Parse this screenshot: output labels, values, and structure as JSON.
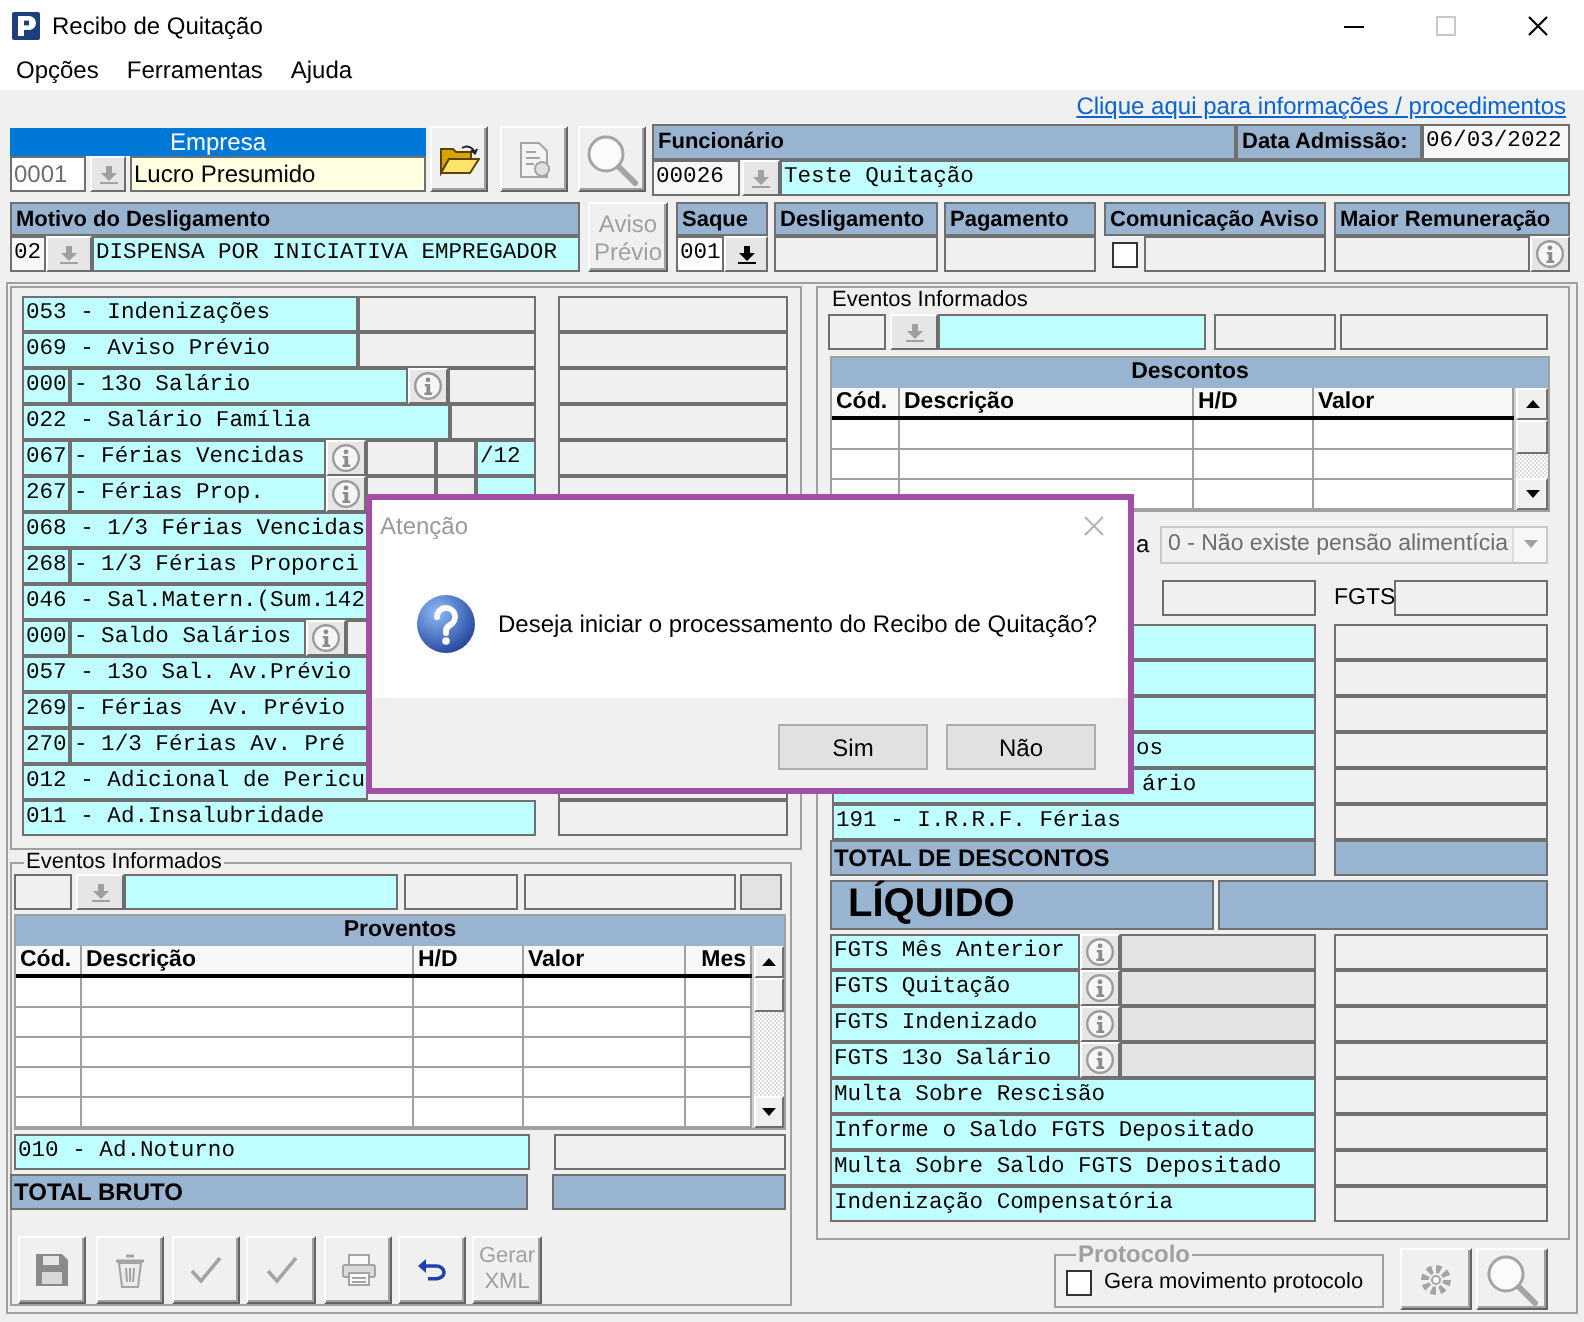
{
  "window": {
    "title": "Recibo de Quitação"
  },
  "menu": [
    "Opções",
    "Ferramentas",
    "Ajuda"
  ],
  "help_link": "Clique aqui para informações / procedimentos",
  "empresa": {
    "label": "Empresa",
    "code": "0001",
    "picker_disabled": true,
    "name": "Lucro Presumido"
  },
  "top_buttons": [
    {
      "kind": "open",
      "disabled": false
    },
    {
      "kind": "document",
      "disabled": true
    },
    {
      "kind": "search",
      "disabled": true
    }
  ],
  "funcionario": {
    "label": "Funcionário",
    "admission_label": "Data Admissão:",
    "admission_date": "06/03/2022",
    "code": "00026",
    "picker_disabled": true,
    "name": "Teste Quitação"
  },
  "motivo": {
    "label": "Motivo do Desligamento",
    "code": "02",
    "picker_disabled": true,
    "description": "DISPENSA POR INICIATIVA EMPREGADOR"
  },
  "aviso_previo": {
    "label": "Aviso Prévio",
    "disabled": true
  },
  "saque": {
    "label": "Saque",
    "code": "001",
    "picker_disabled": false
  },
  "desligamento": {
    "label": "Desligamento"
  },
  "pagamento": {
    "label": "Pagamento"
  },
  "comunicacao_aviso": {
    "label": "Comunicação Aviso",
    "checked": false
  },
  "maior_remuneracao": {
    "label": "Maior Remuneração"
  },
  "proventos_events": [
    {
      "kind": "value",
      "label": "053 - Indenizações"
    },
    {
      "kind": "value",
      "label": "069 - Aviso Prévio"
    },
    {
      "kind": "info",
      "code": "000",
      "label": "- 13o Salário"
    },
    {
      "kind": "value",
      "label": "022 - Salário Família"
    },
    {
      "kind": "months",
      "code": "067",
      "label": "- Férias Vencidas",
      "suffix": "/12"
    },
    {
      "kind": "months",
      "code": "267",
      "label": "- Férias Prop."
    },
    {
      "kind": "text",
      "label": "068 - 1/3 Férias Vencidas"
    },
    {
      "kind": "text",
      "code": "268",
      "label": "- 1/3 Férias Proporci"
    },
    {
      "kind": "text",
      "label": "046 - Sal.Matern.(Sum.142"
    },
    {
      "kind": "info",
      "code": "000",
      "label": "- Saldo Salários"
    },
    {
      "kind": "text",
      "label": "057 - 13o Sal. Av.Prévio"
    },
    {
      "kind": "text",
      "code": "269",
      "label": "- Férias  Av. Prévio"
    },
    {
      "kind": "text",
      "code": "270",
      "label": "- 1/3 Férias Av. Pré"
    },
    {
      "kind": "text",
      "label": "012 - Adicional de Pericu"
    },
    {
      "kind": "text",
      "label": "011 - Ad.Insalubridade"
    }
  ],
  "proventos_input": {
    "label": "Eventos Informados",
    "picker_disabled": true
  },
  "proventos_table": {
    "title": "Proventos",
    "columns": [
      "Cód.",
      "Descrição",
      "H/D",
      "Valor",
      "Mes"
    ]
  },
  "adicional_noturno": "010 - Ad.Noturno",
  "total_bruto": "TOTAL BRUTO",
  "action_buttons": [
    {
      "kind": "save",
      "disabled": true
    },
    {
      "kind": "delete",
      "disabled": true
    },
    {
      "kind": "confirm",
      "disabled": true
    },
    {
      "kind": "confirm",
      "disabled": true
    },
    {
      "kind": "print",
      "disabled": true
    },
    {
      "kind": "undo",
      "disabled": false
    },
    {
      "kind": "xml",
      "label": "Gerar XML",
      "disabled": true
    }
  ],
  "descontos_input": {
    "label": "Eventos Informados",
    "picker_disabled": true
  },
  "descontos_table": {
    "title": "Descontos",
    "columns": [
      "Cód.",
      "Descrição",
      "H/D",
      "Valor"
    ]
  },
  "pension": {
    "label": "a",
    "value": "0 - Não existe pensão alimentícia",
    "disabled": true
  },
  "fgts_label": "FGTS",
  "descontos_events": [
    {
      "label": "os"
    },
    {
      "label": "ário"
    },
    {
      "label": "191 - I.R.R.F. Férias"
    }
  ],
  "total_descontos": "TOTAL DE DESCONTOS",
  "liquido": "LÍQUIDO",
  "fgts_items": [
    {
      "kind": "info",
      "label": "FGTS Mês Anterior"
    },
    {
      "kind": "info",
      "label": "FGTS Quitação"
    },
    {
      "kind": "info",
      "label": "FGTS Indenizado"
    },
    {
      "kind": "info",
      "label": "FGTS 13o Salário"
    },
    {
      "kind": "plain",
      "label": "Multa Sobre Rescisão"
    },
    {
      "kind": "plain",
      "label": "Informe o Saldo FGTS Depositado"
    },
    {
      "kind": "plain",
      "label": "Multa Sobre Saldo FGTS Depositado"
    },
    {
      "kind": "plain",
      "label": "Indenização Compensatória"
    }
  ],
  "protocolo": {
    "legend": "Protocolo",
    "disabled": true,
    "checkbox_label": "Gera movimento protocolo",
    "checked": false
  },
  "protocolo_buttons": [
    {
      "kind": "settings",
      "disabled": true
    },
    {
      "kind": "search",
      "disabled": true
    }
  ],
  "dialog": {
    "title": "Atenção",
    "message": "Deseja iniciar o processamento do Recibo de Quitação?",
    "buttons": [
      "Sim",
      "Não"
    ]
  }
}
